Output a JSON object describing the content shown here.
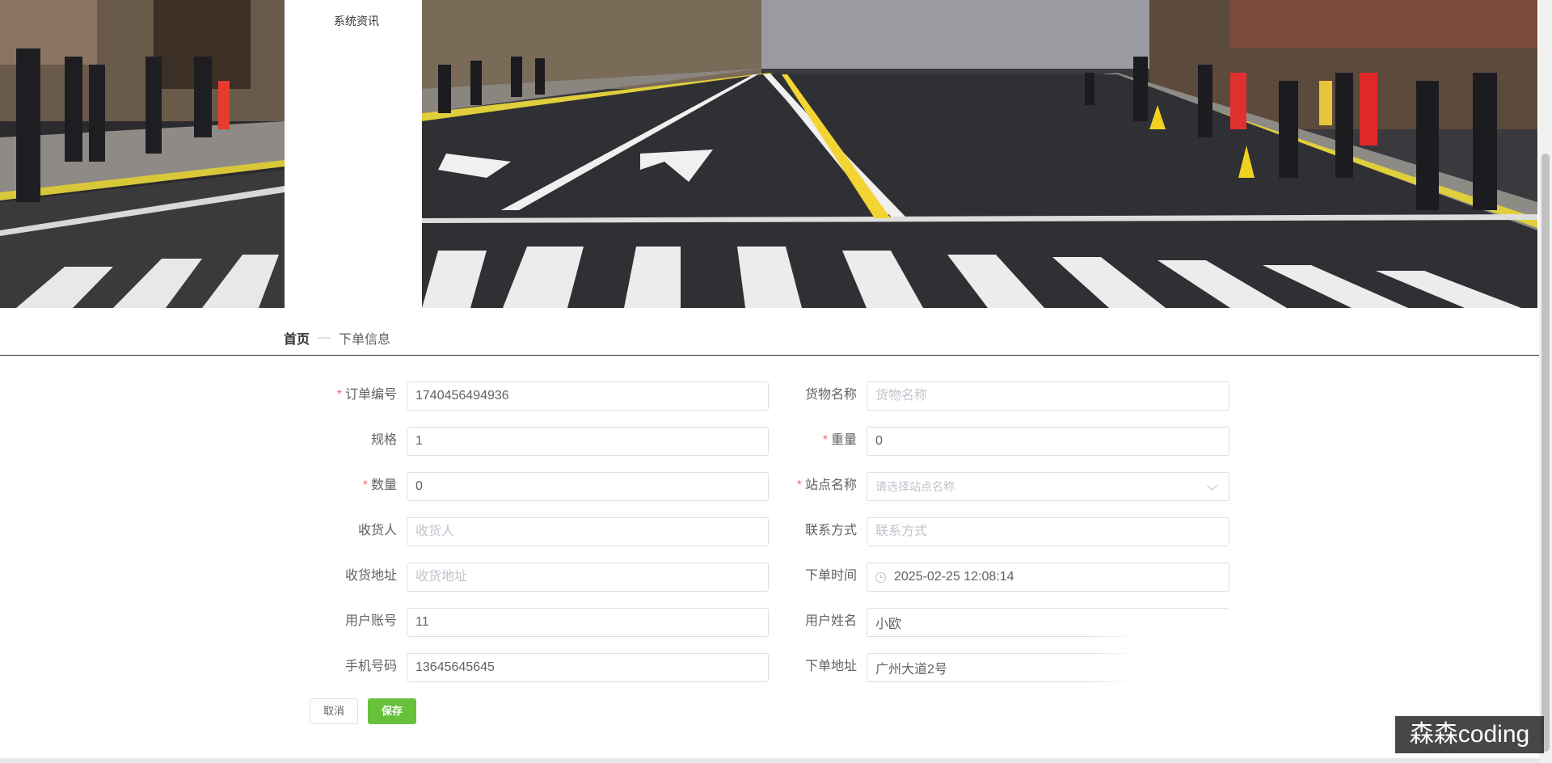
{
  "nav": {
    "menu_item": "系统资讯"
  },
  "breadcrumb": {
    "home": "首页",
    "separator": "—",
    "current": "下单信息"
  },
  "form": {
    "fields": [
      {
        "label": "订单编号",
        "required": true,
        "value": "1740456494936",
        "placeholder": ""
      },
      {
        "label": "货物名称",
        "required": false,
        "value": "",
        "placeholder": "货物名称"
      },
      {
        "label": "规格",
        "required": false,
        "value": "1",
        "placeholder": ""
      },
      {
        "label": "重量",
        "required": true,
        "value": "0",
        "placeholder": ""
      },
      {
        "label": "数量",
        "required": true,
        "value": "0",
        "placeholder": ""
      },
      {
        "label": "站点名称",
        "required": true,
        "value": "",
        "placeholder": "请选择站点名称",
        "type": "select"
      },
      {
        "label": "收货人",
        "required": false,
        "value": "",
        "placeholder": "收货人"
      },
      {
        "label": "联系方式",
        "required": false,
        "value": "",
        "placeholder": "联系方式"
      },
      {
        "label": "收货地址",
        "required": false,
        "value": "",
        "placeholder": "收货地址"
      },
      {
        "label": "下单时间",
        "required": false,
        "value": "2025-02-25 12:08:14",
        "type": "datetime",
        "icon": "clock-icon"
      },
      {
        "label": "用户账号",
        "required": false,
        "value": "11",
        "placeholder": ""
      },
      {
        "label": "用户姓名",
        "required": false,
        "value": "小欧",
        "placeholder": ""
      },
      {
        "label": "手机号码",
        "required": false,
        "value": "13645645645",
        "placeholder": ""
      },
      {
        "label": "下单地址",
        "required": false,
        "value": "广州大道2号",
        "placeholder": ""
      }
    ],
    "required_mark": "*"
  },
  "buttons": {
    "cancel": "取消",
    "save": "保存"
  },
  "watermark": "森森coding",
  "colors": {
    "primary_green": "#67c23a",
    "required_red": "#f56c6c",
    "border": "#dcdfe6",
    "placeholder": "#c0c4cc"
  }
}
